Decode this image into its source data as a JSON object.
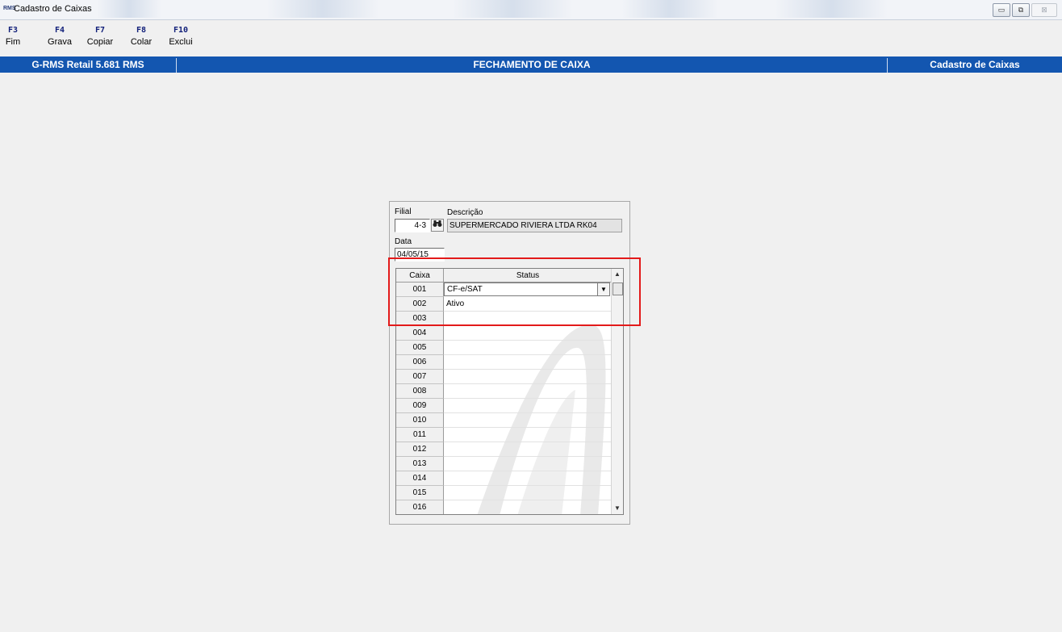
{
  "window": {
    "app_icon_text": "RMS",
    "title": "Cadastro de Caixas",
    "controls": {
      "minimize": "▭",
      "maximize": "⧉",
      "close": "⊠"
    }
  },
  "toolbar": {
    "items": [
      {
        "key": "F3",
        "label": "Fim"
      },
      {
        "key": "F4",
        "label": "Grava"
      },
      {
        "key": "F7",
        "label": "Copiar"
      },
      {
        "key": "F8",
        "label": "Colar"
      },
      {
        "key": "F10",
        "label": "Exclui"
      }
    ]
  },
  "header_bar": {
    "app_version": "G-RMS Retail 5.681 RMS",
    "module": "FECHAMENTO DE CAIXA",
    "screen": "Cadastro de Caixas",
    "color": "#1356b0"
  },
  "form": {
    "filial_label": "Filial",
    "filial_value": "4-3",
    "descricao_label": "Descrição",
    "descricao_value": "SUPERMERCADO RIVIERA LTDA RK04",
    "data_label": "Data",
    "data_value": "04/05/15",
    "search_icon": "binoculars-icon"
  },
  "grid": {
    "col_caixa": "Caixa",
    "col_status": "Status",
    "dropdown_arrow": "▼",
    "scroll_up": "▲",
    "scroll_down": "▼",
    "rows": [
      {
        "caixa": "001",
        "status": "CF-e/SAT"
      },
      {
        "caixa": "002",
        "status": "Ativo"
      },
      {
        "caixa": "003",
        "status": ""
      },
      {
        "caixa": "004",
        "status": ""
      },
      {
        "caixa": "005",
        "status": ""
      },
      {
        "caixa": "006",
        "status": ""
      },
      {
        "caixa": "007",
        "status": ""
      },
      {
        "caixa": "008",
        "status": ""
      },
      {
        "caixa": "009",
        "status": ""
      },
      {
        "caixa": "010",
        "status": ""
      },
      {
        "caixa": "011",
        "status": ""
      },
      {
        "caixa": "012",
        "status": ""
      },
      {
        "caixa": "013",
        "status": ""
      },
      {
        "caixa": "014",
        "status": ""
      },
      {
        "caixa": "015",
        "status": ""
      },
      {
        "caixa": "016",
        "status": ""
      }
    ]
  },
  "highlight_color": "#e31a1a"
}
